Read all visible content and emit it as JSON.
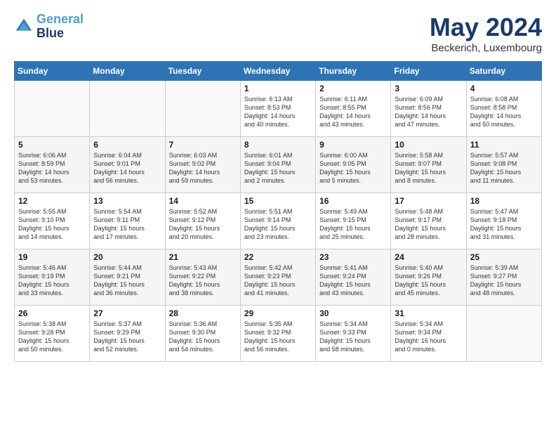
{
  "header": {
    "logo_line1": "General",
    "logo_line2": "Blue",
    "month": "May 2024",
    "location": "Beckerich, Luxembourg"
  },
  "days_of_week": [
    "Sunday",
    "Monday",
    "Tuesday",
    "Wednesday",
    "Thursday",
    "Friday",
    "Saturday"
  ],
  "weeks": [
    [
      {
        "num": "",
        "info": ""
      },
      {
        "num": "",
        "info": ""
      },
      {
        "num": "",
        "info": ""
      },
      {
        "num": "1",
        "info": "Sunrise: 6:13 AM\nSunset: 8:53 PM\nDaylight: 14 hours\nand 40 minutes."
      },
      {
        "num": "2",
        "info": "Sunrise: 6:11 AM\nSunset: 8:55 PM\nDaylight: 14 hours\nand 43 minutes."
      },
      {
        "num": "3",
        "info": "Sunrise: 6:09 AM\nSunset: 8:56 PM\nDaylight: 14 hours\nand 47 minutes."
      },
      {
        "num": "4",
        "info": "Sunrise: 6:08 AM\nSunset: 8:58 PM\nDaylight: 14 hours\nand 50 minutes."
      }
    ],
    [
      {
        "num": "5",
        "info": "Sunrise: 6:06 AM\nSunset: 8:59 PM\nDaylight: 14 hours\nand 53 minutes."
      },
      {
        "num": "6",
        "info": "Sunrise: 6:04 AM\nSunset: 9:01 PM\nDaylight: 14 hours\nand 56 minutes."
      },
      {
        "num": "7",
        "info": "Sunrise: 6:03 AM\nSunset: 9:02 PM\nDaylight: 14 hours\nand 59 minutes."
      },
      {
        "num": "8",
        "info": "Sunrise: 6:01 AM\nSunset: 9:04 PM\nDaylight: 15 hours\nand 2 minutes."
      },
      {
        "num": "9",
        "info": "Sunrise: 6:00 AM\nSunset: 9:05 PM\nDaylight: 15 hours\nand 5 minutes."
      },
      {
        "num": "10",
        "info": "Sunrise: 5:58 AM\nSunset: 9:07 PM\nDaylight: 15 hours\nand 8 minutes."
      },
      {
        "num": "11",
        "info": "Sunrise: 5:57 AM\nSunset: 9:08 PM\nDaylight: 15 hours\nand 11 minutes."
      }
    ],
    [
      {
        "num": "12",
        "info": "Sunrise: 5:55 AM\nSunset: 9:10 PM\nDaylight: 15 hours\nand 14 minutes."
      },
      {
        "num": "13",
        "info": "Sunrise: 5:54 AM\nSunset: 9:11 PM\nDaylight: 15 hours\nand 17 minutes."
      },
      {
        "num": "14",
        "info": "Sunrise: 5:52 AM\nSunset: 9:12 PM\nDaylight: 15 hours\nand 20 minutes."
      },
      {
        "num": "15",
        "info": "Sunrise: 5:51 AM\nSunset: 9:14 PM\nDaylight: 15 hours\nand 23 minutes."
      },
      {
        "num": "16",
        "info": "Sunrise: 5:49 AM\nSunset: 9:15 PM\nDaylight: 15 hours\nand 25 minutes."
      },
      {
        "num": "17",
        "info": "Sunrise: 5:48 AM\nSunset: 9:17 PM\nDaylight: 15 hours\nand 28 minutes."
      },
      {
        "num": "18",
        "info": "Sunrise: 5:47 AM\nSunset: 9:18 PM\nDaylight: 15 hours\nand 31 minutes."
      }
    ],
    [
      {
        "num": "19",
        "info": "Sunrise: 5:46 AM\nSunset: 9:19 PM\nDaylight: 15 hours\nand 33 minutes."
      },
      {
        "num": "20",
        "info": "Sunrise: 5:44 AM\nSunset: 9:21 PM\nDaylight: 15 hours\nand 36 minutes."
      },
      {
        "num": "21",
        "info": "Sunrise: 5:43 AM\nSunset: 9:22 PM\nDaylight: 15 hours\nand 38 minutes."
      },
      {
        "num": "22",
        "info": "Sunrise: 5:42 AM\nSunset: 9:23 PM\nDaylight: 15 hours\nand 41 minutes."
      },
      {
        "num": "23",
        "info": "Sunrise: 5:41 AM\nSunset: 9:24 PM\nDaylight: 15 hours\nand 43 minutes."
      },
      {
        "num": "24",
        "info": "Sunrise: 5:40 AM\nSunset: 9:26 PM\nDaylight: 15 hours\nand 45 minutes."
      },
      {
        "num": "25",
        "info": "Sunrise: 5:39 AM\nSunset: 9:27 PM\nDaylight: 15 hours\nand 48 minutes."
      }
    ],
    [
      {
        "num": "26",
        "info": "Sunrise: 5:38 AM\nSunset: 9:28 PM\nDaylight: 15 hours\nand 50 minutes."
      },
      {
        "num": "27",
        "info": "Sunrise: 5:37 AM\nSunset: 9:29 PM\nDaylight: 15 hours\nand 52 minutes."
      },
      {
        "num": "28",
        "info": "Sunrise: 5:36 AM\nSunset: 9:30 PM\nDaylight: 15 hours\nand 54 minutes."
      },
      {
        "num": "29",
        "info": "Sunrise: 5:35 AM\nSunset: 9:32 PM\nDaylight: 15 hours\nand 56 minutes."
      },
      {
        "num": "30",
        "info": "Sunrise: 5:34 AM\nSunset: 9:33 PM\nDaylight: 15 hours\nand 58 minutes."
      },
      {
        "num": "31",
        "info": "Sunrise: 5:34 AM\nSunset: 9:34 PM\nDaylight: 16 hours\nand 0 minutes."
      },
      {
        "num": "",
        "info": ""
      }
    ]
  ]
}
